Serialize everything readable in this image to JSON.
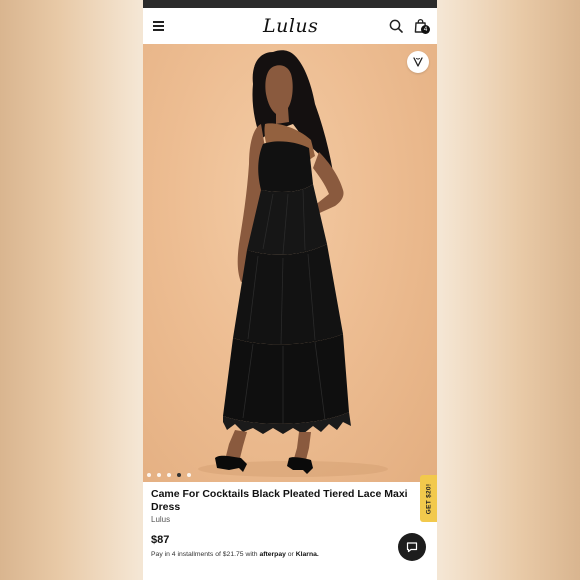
{
  "header": {
    "logo_text": "Lulus",
    "bag_count": "4"
  },
  "gallery": {
    "dot_count": 5,
    "active_index": 3
  },
  "product": {
    "title": "Came For Cocktails Black Pleated Tiered Lace Maxi Dress",
    "brand": "Lulus",
    "price": "$87",
    "installment_text": "Pay in 4 installments of $21.75 with",
    "afterpay_label": "afterpay",
    "or_text": "or",
    "klarna_label": "Klarna."
  },
  "promo_tab": {
    "label": "GET $20!"
  },
  "colors": {
    "background_side": "#e8c9a6",
    "hero_backdrop": "#edbd92",
    "promo_tab": "#f2c94c",
    "dress": "#111111"
  }
}
